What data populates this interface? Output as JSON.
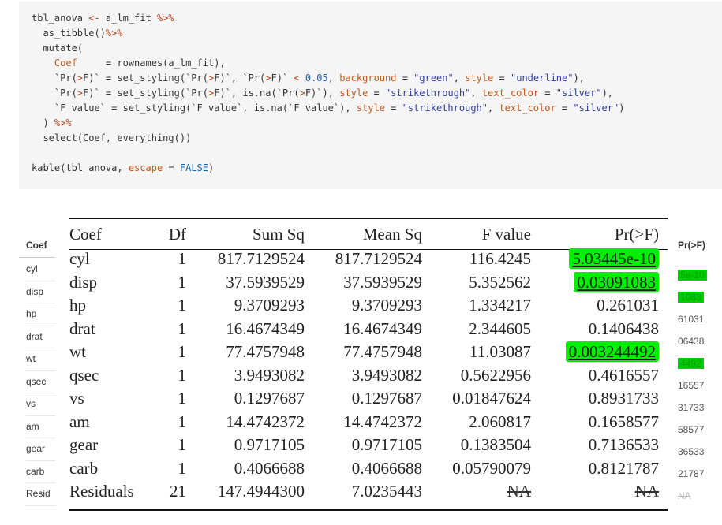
{
  "code": {
    "lines": [
      [
        [
          "tbl_anova ",
          ""
        ],
        [
          "<-",
          "op"
        ],
        [
          " a_lm_fit ",
          ""
        ],
        [
          "%>%",
          "op"
        ]
      ],
      [
        [
          "  as_tibble()",
          ""
        ],
        [
          "%>%",
          "op"
        ]
      ],
      [
        [
          "  mutate(",
          ""
        ]
      ],
      [
        [
          "    ",
          ""
        ],
        [
          "Coef",
          "arg"
        ],
        [
          "     = rownames(a_lm_fit),",
          ""
        ]
      ],
      [
        [
          "    `Pr(",
          ""
        ],
        [
          ">",
          "op"
        ],
        [
          "F)` = set_styling(`Pr(",
          ""
        ],
        [
          ">",
          "op"
        ],
        [
          "F)`, `Pr(",
          ""
        ],
        [
          ">",
          "op"
        ],
        [
          "F)` ",
          ""
        ],
        [
          "<",
          "op"
        ],
        [
          " ",
          ""
        ],
        [
          "0.05",
          "num"
        ],
        [
          ", ",
          ""
        ],
        [
          "background",
          "arg"
        ],
        [
          " = ",
          ""
        ],
        [
          "\"green\"",
          "str"
        ],
        [
          ", ",
          ""
        ],
        [
          "style",
          "arg"
        ],
        [
          " = ",
          ""
        ],
        [
          "\"underline\"",
          "str"
        ],
        [
          "),",
          ""
        ]
      ],
      [
        [
          "    `Pr(",
          ""
        ],
        [
          ">",
          "op"
        ],
        [
          "F)` = set_styling(`Pr(",
          ""
        ],
        [
          ">",
          "op"
        ],
        [
          "F)`, is.na(`Pr(",
          ""
        ],
        [
          ">",
          "op"
        ],
        [
          "F)`), ",
          ""
        ],
        [
          "style",
          "arg"
        ],
        [
          " = ",
          ""
        ],
        [
          "\"strikethrough\"",
          "str"
        ],
        [
          ", ",
          ""
        ],
        [
          "text_color",
          "arg"
        ],
        [
          " = ",
          ""
        ],
        [
          "\"silver\"",
          "str"
        ],
        [
          "),",
          ""
        ]
      ],
      [
        [
          "    `F value` = set_styling(`F value`, is.na(`F value`), ",
          ""
        ],
        [
          "style",
          "arg"
        ],
        [
          " = ",
          ""
        ],
        [
          "\"strikethrough\"",
          "str"
        ],
        [
          ", ",
          ""
        ],
        [
          "text_color",
          "arg"
        ],
        [
          " = ",
          ""
        ],
        [
          "\"silver\"",
          "str"
        ],
        [
          ")",
          ""
        ]
      ],
      [
        [
          "  ) ",
          ""
        ],
        [
          "%>%",
          "op"
        ]
      ],
      [
        [
          "  select(Coef, everything())",
          ""
        ]
      ],
      [
        [
          "",
          ""
        ]
      ],
      [
        [
          "kable(tbl_anova, ",
          ""
        ],
        [
          "escape",
          "arg"
        ],
        [
          " = ",
          ""
        ],
        [
          "FALSE",
          "kw"
        ],
        [
          ")",
          ""
        ]
      ]
    ]
  },
  "bg_table": {
    "header": "Coef",
    "rows": [
      "cyl",
      "disp",
      "hp",
      "drat",
      "wt",
      "qsec",
      "vs",
      "am",
      "gear",
      "carb",
      "Resid"
    ]
  },
  "right_clip": {
    "header": "Pr(>F)",
    "cells": [
      {
        "text": "5e-10",
        "style": "green"
      },
      {
        "text": "1083",
        "style": "green"
      },
      {
        "text": "61031",
        "style": "plain"
      },
      {
        "text": "06438",
        "style": "plain"
      },
      {
        "text": "4492",
        "style": "green"
      },
      {
        "text": "16557",
        "style": "plain"
      },
      {
        "text": "31733",
        "style": "plain"
      },
      {
        "text": "58577",
        "style": "plain"
      },
      {
        "text": "36533",
        "style": "plain"
      },
      {
        "text": "21787",
        "style": "plain"
      },
      {
        "text": "NA",
        "style": "na"
      }
    ]
  },
  "table": {
    "headers": [
      "Coef",
      "Df",
      "Sum Sq",
      "Mean Sq",
      "F value",
      "Pr(>F)"
    ],
    "rows": [
      {
        "coef": "cyl",
        "df": "1",
        "sum_sq": "817.7129524",
        "mean_sq": "817.7129524",
        "f_value": "116.4245",
        "pr": "5.03445e-10",
        "pr_style": "green"
      },
      {
        "coef": "disp",
        "df": "1",
        "sum_sq": "37.5939529",
        "mean_sq": "37.5939529",
        "f_value": "5.352562",
        "pr": "0.03091083",
        "pr_style": "green"
      },
      {
        "coef": "hp",
        "df": "1",
        "sum_sq": "9.3709293",
        "mean_sq": "9.3709293",
        "f_value": "1.334217",
        "pr": "0.261031",
        "pr_style": "plain"
      },
      {
        "coef": "drat",
        "df": "1",
        "sum_sq": "16.4674349",
        "mean_sq": "16.4674349",
        "f_value": "2.344605",
        "pr": "0.1406438",
        "pr_style": "plain"
      },
      {
        "coef": "wt",
        "df": "1",
        "sum_sq": "77.4757948",
        "mean_sq": "77.4757948",
        "f_value": "11.03087",
        "pr": "0.003244492",
        "pr_style": "green"
      },
      {
        "coef": "qsec",
        "df": "1",
        "sum_sq": "3.9493082",
        "mean_sq": "3.9493082",
        "f_value": "0.5622956",
        "pr": "0.4616557",
        "pr_style": "plain"
      },
      {
        "coef": "vs",
        "df": "1",
        "sum_sq": "0.1297687",
        "mean_sq": "0.1297687",
        "f_value": "0.01847624",
        "pr": "0.8931733",
        "pr_style": "plain"
      },
      {
        "coef": "am",
        "df": "1",
        "sum_sq": "14.4742372",
        "mean_sq": "14.4742372",
        "f_value": "2.060817",
        "pr": "0.1658577",
        "pr_style": "plain"
      },
      {
        "coef": "gear",
        "df": "1",
        "sum_sq": "0.9717105",
        "mean_sq": "0.9717105",
        "f_value": "0.1383504",
        "pr": "0.7136533",
        "pr_style": "plain"
      },
      {
        "coef": "carb",
        "df": "1",
        "sum_sq": "0.4066688",
        "mean_sq": "0.4066688",
        "f_value": "0.05790079",
        "pr": "0.8121787",
        "pr_style": "plain"
      },
      {
        "coef": "Residuals",
        "df": "21",
        "sum_sq": "147.4944300",
        "mean_sq": "7.0235443",
        "f_value": "NA",
        "pr": "NA",
        "pr_style": "na",
        "f_style": "na"
      }
    ]
  }
}
